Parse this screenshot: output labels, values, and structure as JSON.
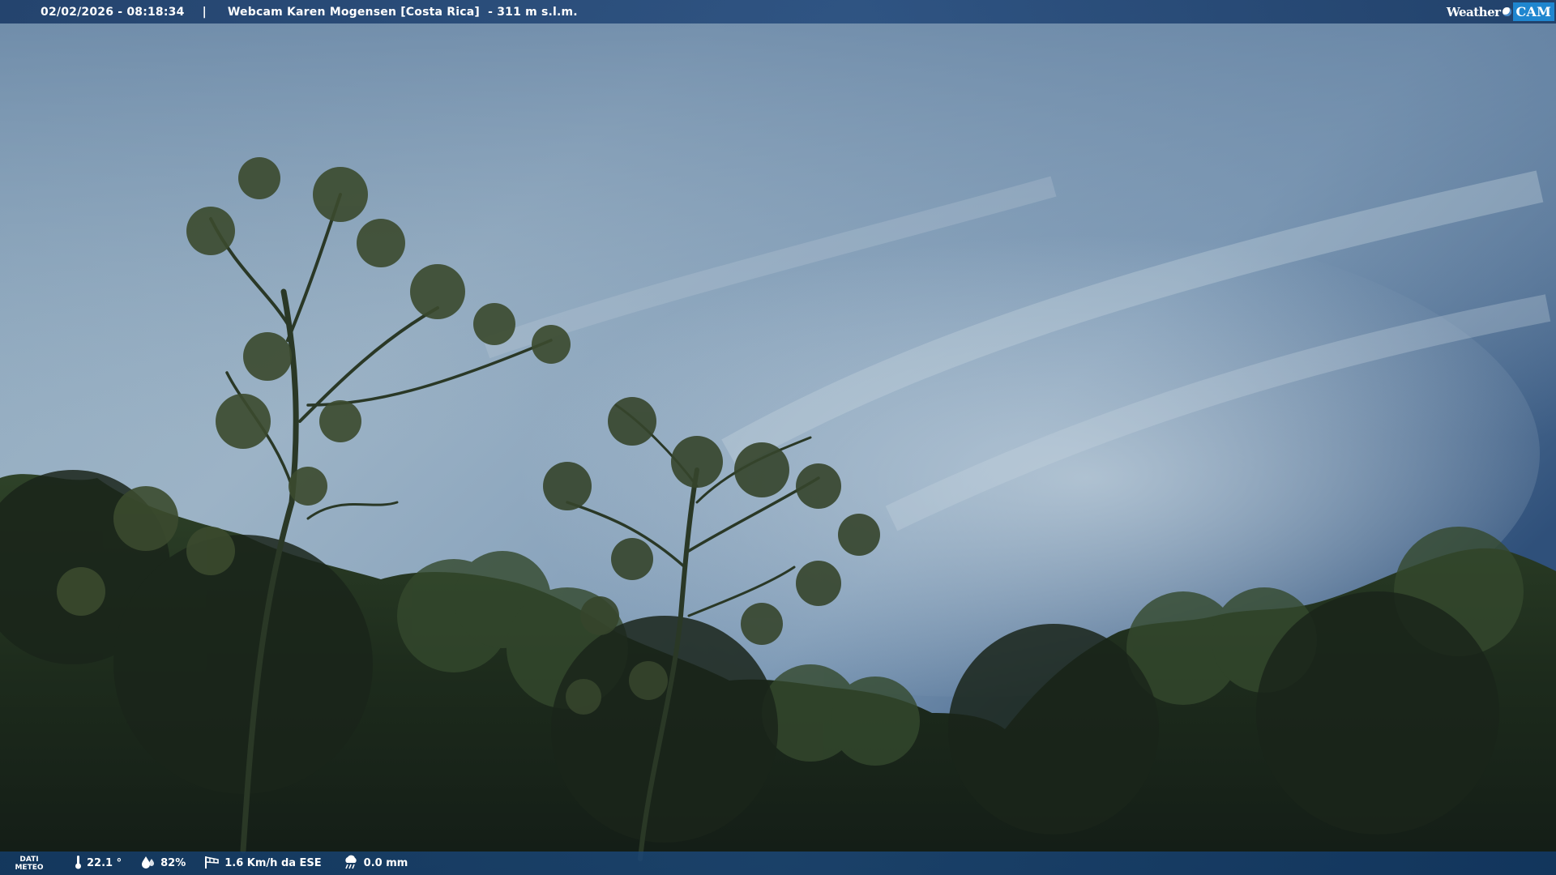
{
  "top_bar": {
    "datetime": "02/02/2026 - 08:18:34",
    "separator": "|",
    "webcam_title": "Webcam Karen Mogensen [Costa Rica]  - 311 m s.l.m.",
    "logo": {
      "part1": "Weather",
      "part2": "CAM"
    }
  },
  "bottom_bar": {
    "label_line1": "DATI",
    "label_line2": "METEO",
    "temperature": "22.1 °",
    "humidity": "82%",
    "wind": "1.6 Km/h da ESE",
    "rain": "0.0 mm"
  },
  "icons": {
    "temperature": "thermometer-icon",
    "humidity": "water-drops-icon",
    "wind": "windsock-icon",
    "rain": "rain-cloud-icon"
  },
  "colors": {
    "bar_blue": "#1e3e69",
    "logo_blue": "#1f86cf",
    "sky_light": "#a9bfd0",
    "sky_dark": "#2a4a72",
    "foliage_dark": "#1c2a1c"
  }
}
